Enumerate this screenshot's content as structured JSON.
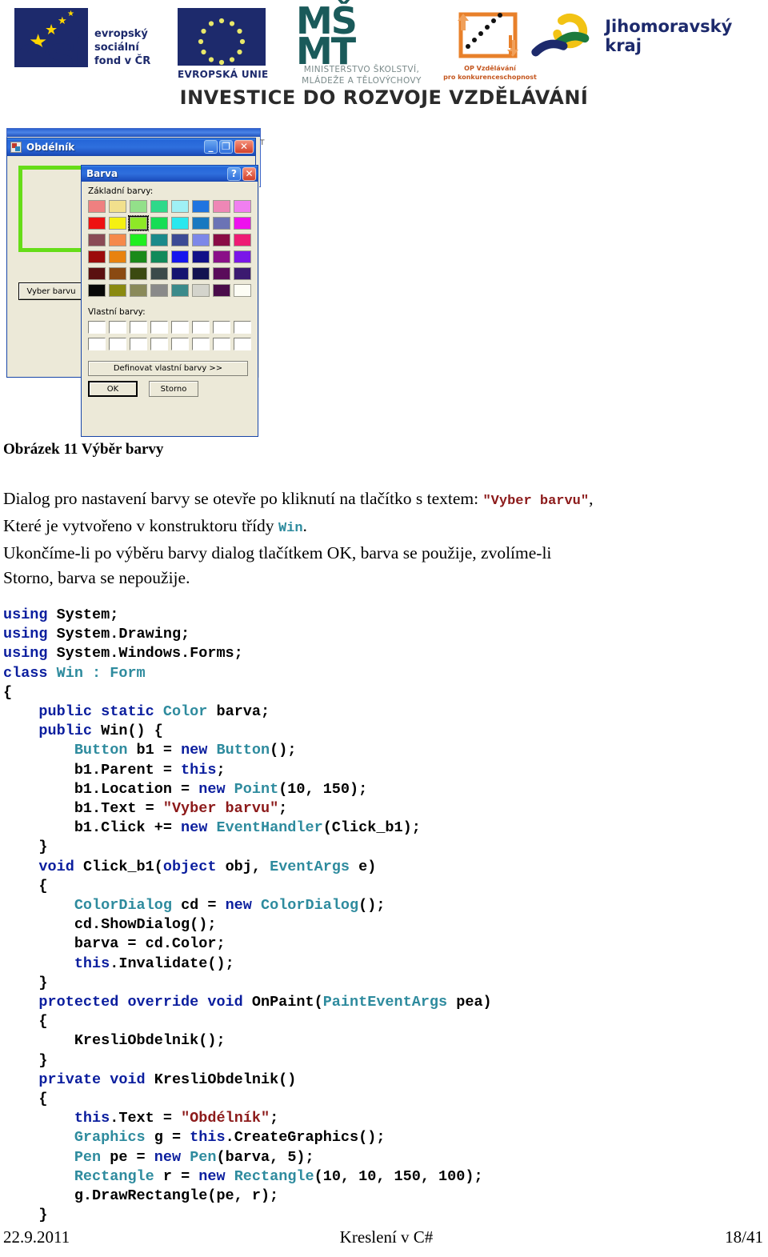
{
  "header": {
    "logos": [
      {
        "name": "esf",
        "line1": "evropský",
        "line2": "sociální",
        "line3": "fond v ČR",
        "mark": "esf"
      },
      {
        "name": "eu",
        "caption": "EVROPSKÁ UNIE"
      },
      {
        "name": "msmt",
        "mark1": "MŠ",
        "mark2": "MT",
        "caption": "MINISTERSTVO ŠKOLSTVÍ,\nMLÁDEŽE A TĚLOVÝCHOVY"
      },
      {
        "name": "op-vzdelavani",
        "caption1": "OP Vzdělávání",
        "caption2": "pro konkurenceschopnost"
      },
      {
        "name": "jihomoravsky-kraj",
        "text": "Jihomoravský kraj"
      }
    ],
    "slogan": "INVESTICE DO ROZVOJE VZDĚLÁVÁNÍ"
  },
  "figure": {
    "app_window": {
      "title": "Obdélník",
      "minimize_label": "_",
      "maximize_label": "❐",
      "close_label": "✕",
      "button_label": "Vyber barvu",
      "rect_color": "#66dd18"
    },
    "color_dialog": {
      "title": "Barva",
      "help_label": "?",
      "close_label": "✕",
      "basic_label": "Základní barvy:",
      "custom_label": "Vlastní barvy:",
      "define_label": "Definovat vlastní barvy >>",
      "ok_label": "OK",
      "cancel_label": "Storno",
      "selected_index": 10,
      "basic_colors": [
        "#ef8080",
        "#f2e08d",
        "#93e08a",
        "#2fd98a",
        "#9ff0f5",
        "#1f74e0",
        "#ee87b6",
        "#f07ff0",
        "#ee1111",
        "#f5f012",
        "#8ee827",
        "#16dd55",
        "#2ae8ee",
        "#1878c0",
        "#6b73b5",
        "#ee11ee",
        "#8a4a55",
        "#f5894a",
        "#20ee20",
        "#1a8a8a",
        "#3b4a95",
        "#7d88e8",
        "#8a0c46",
        "#ee1a74",
        "#9c0b0b",
        "#e8820f",
        "#1a8a1a",
        "#108a5a",
        "#1616ee",
        "#101088",
        "#8a1088",
        "#7a16e8",
        "#5a1010",
        "#8a4a12",
        "#3b4a10",
        "#3b4a4a",
        "#141470",
        "#121250",
        "#5a0c5a",
        "#3b1a70",
        "#080808",
        "#8a8a10",
        "#8a8a5a",
        "#8a8a8a",
        "#3b8a8a",
        "#d4d4cc",
        "#4a0c4a",
        "#fdfdf5"
      ],
      "custom_slots": 16
    },
    "behind_window_hint": "T"
  },
  "document": {
    "caption": "Obrázek 11 Výběr barvy",
    "para1_a": "Dialog pro nastavení barvy se otevře po kliknutí na tlačítko s textem: ",
    "para1_code": "\"Vyber barvu\"",
    "para1_b": ",",
    "para2_a": "Které je vytvořeno v konstruktoru třídy ",
    "para2_code": "Win",
    "para2_b": ".",
    "para3": "Ukončíme-li po výběru barvy dialog tlačítkem OK, barva se použije, zvolíme-li",
    "para4": "Storno, barva se nepoužije."
  },
  "code": {
    "lines": [
      [
        {
          "t": "using ",
          "c": "k"
        },
        {
          "t": "System;",
          "c": "pl"
        }
      ],
      [
        {
          "t": "using ",
          "c": "k"
        },
        {
          "t": "System.Drawing;",
          "c": "pl"
        }
      ],
      [
        {
          "t": "using ",
          "c": "k"
        },
        {
          "t": "System.Windows.Forms;",
          "c": "pl"
        }
      ],
      [
        {
          "t": "class ",
          "c": "k"
        },
        {
          "t": "Win : Form",
          "c": "t"
        }
      ],
      [
        {
          "t": "{",
          "c": "pl"
        }
      ],
      [
        {
          "t": "    ",
          "c": "pl"
        },
        {
          "t": "public static ",
          "c": "k"
        },
        {
          "t": "Color ",
          "c": "t"
        },
        {
          "t": "barva;",
          "c": "pl"
        }
      ],
      [
        {
          "t": "    ",
          "c": "pl"
        },
        {
          "t": "public ",
          "c": "k"
        },
        {
          "t": "Win() {",
          "c": "pl"
        }
      ],
      [
        {
          "t": "        ",
          "c": "pl"
        },
        {
          "t": "Button ",
          "c": "t"
        },
        {
          "t": "b1 = ",
          "c": "pl"
        },
        {
          "t": "new ",
          "c": "k"
        },
        {
          "t": "Button",
          "c": "t"
        },
        {
          "t": "();",
          "c": "pl"
        }
      ],
      [
        {
          "t": "        b1.Parent = ",
          "c": "pl"
        },
        {
          "t": "this",
          "c": "k"
        },
        {
          "t": ";",
          "c": "pl"
        }
      ],
      [
        {
          "t": "        b1.Location = ",
          "c": "pl"
        },
        {
          "t": "new ",
          "c": "k"
        },
        {
          "t": "Point",
          "c": "t"
        },
        {
          "t": "(10, 150);",
          "c": "pl"
        }
      ],
      [
        {
          "t": "        b1.Text = ",
          "c": "pl"
        },
        {
          "t": "\"Vyber barvu\"",
          "c": "s"
        },
        {
          "t": ";",
          "c": "pl"
        }
      ],
      [
        {
          "t": "        b1.Click += ",
          "c": "pl"
        },
        {
          "t": "new ",
          "c": "k"
        },
        {
          "t": "EventHandler",
          "c": "t"
        },
        {
          "t": "(Click_b1);",
          "c": "pl"
        }
      ],
      [
        {
          "t": "    }",
          "c": "pl"
        }
      ],
      [
        {
          "t": "    ",
          "c": "pl"
        },
        {
          "t": "void ",
          "c": "k"
        },
        {
          "t": "Click_b1(",
          "c": "pl"
        },
        {
          "t": "object ",
          "c": "k"
        },
        {
          "t": "obj, ",
          "c": "pl"
        },
        {
          "t": "EventArgs ",
          "c": "t"
        },
        {
          "t": "e)",
          "c": "pl"
        }
      ],
      [
        {
          "t": "    {",
          "c": "pl"
        }
      ],
      [
        {
          "t": "        ",
          "c": "pl"
        },
        {
          "t": "ColorDialog ",
          "c": "t"
        },
        {
          "t": "cd = ",
          "c": "pl"
        },
        {
          "t": "new ",
          "c": "k"
        },
        {
          "t": "ColorDialog",
          "c": "t"
        },
        {
          "t": "();",
          "c": "pl"
        }
      ],
      [
        {
          "t": "        cd.ShowDialog();",
          "c": "pl"
        }
      ],
      [
        {
          "t": "        barva = cd.Color;",
          "c": "pl"
        }
      ],
      [
        {
          "t": "        ",
          "c": "pl"
        },
        {
          "t": "this",
          "c": "k"
        },
        {
          "t": ".Invalidate();",
          "c": "pl"
        }
      ],
      [
        {
          "t": "    }",
          "c": "pl"
        }
      ],
      [
        {
          "t": "    ",
          "c": "pl"
        },
        {
          "t": "protected override void ",
          "c": "k"
        },
        {
          "t": "OnPaint(",
          "c": "pl"
        },
        {
          "t": "PaintEventArgs ",
          "c": "t"
        },
        {
          "t": "pea)",
          "c": "pl"
        }
      ],
      [
        {
          "t": "    {",
          "c": "pl"
        }
      ],
      [
        {
          "t": "        KresliObdelnik();",
          "c": "pl"
        }
      ],
      [
        {
          "t": "    }",
          "c": "pl"
        }
      ],
      [
        {
          "t": "    ",
          "c": "pl"
        },
        {
          "t": "private void ",
          "c": "k"
        },
        {
          "t": "KresliObdelnik()",
          "c": "pl"
        }
      ],
      [
        {
          "t": "    {",
          "c": "pl"
        }
      ],
      [
        {
          "t": "        ",
          "c": "pl"
        },
        {
          "t": "this",
          "c": "k"
        },
        {
          "t": ".Text = ",
          "c": "pl"
        },
        {
          "t": "\"Obdélník\"",
          "c": "s"
        },
        {
          "t": ";",
          "c": "pl"
        }
      ],
      [
        {
          "t": "        ",
          "c": "pl"
        },
        {
          "t": "Graphics ",
          "c": "t"
        },
        {
          "t": "g = ",
          "c": "pl"
        },
        {
          "t": "this",
          "c": "k"
        },
        {
          "t": ".CreateGraphics();",
          "c": "pl"
        }
      ],
      [
        {
          "t": "        ",
          "c": "pl"
        },
        {
          "t": "Pen ",
          "c": "t"
        },
        {
          "t": "pe = ",
          "c": "pl"
        },
        {
          "t": "new ",
          "c": "k"
        },
        {
          "t": "Pen",
          "c": "t"
        },
        {
          "t": "(barva, 5);",
          "c": "pl"
        }
      ],
      [
        {
          "t": "        ",
          "c": "pl"
        },
        {
          "t": "Rectangle ",
          "c": "t"
        },
        {
          "t": "r = ",
          "c": "pl"
        },
        {
          "t": "new ",
          "c": "k"
        },
        {
          "t": "Rectangle",
          "c": "t"
        },
        {
          "t": "(10, 10, 150, 100);",
          "c": "pl"
        }
      ],
      [
        {
          "t": "        g.DrawRectangle(pe, r);",
          "c": "pl"
        }
      ],
      [
        {
          "t": "    }",
          "c": "pl"
        }
      ]
    ]
  },
  "footer": {
    "date": "22.9.2011",
    "title": "Kreslení v C#",
    "page": "18/41"
  }
}
